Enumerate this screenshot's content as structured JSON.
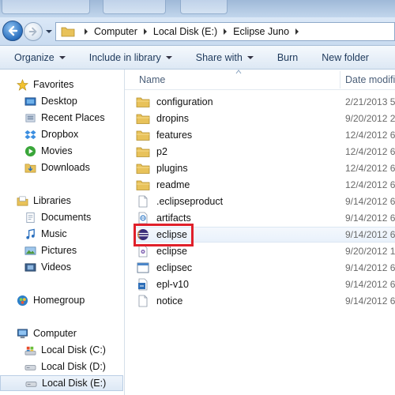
{
  "address_bar": {
    "breadcrumbs": [
      "Computer",
      "Local Disk (E:)",
      "Eclipse Juno"
    ]
  },
  "toolbar": {
    "organize": "Organize",
    "include_in_library": "Include in library",
    "share_with": "Share with",
    "burn": "Burn",
    "new_folder": "New folder"
  },
  "nav_pane": {
    "favorites": {
      "label": "Favorites",
      "items": [
        "Desktop",
        "Recent Places",
        "Dropbox",
        "Movies",
        "Downloads"
      ]
    },
    "libraries": {
      "label": "Libraries",
      "items": [
        "Documents",
        "Music",
        "Pictures",
        "Videos"
      ]
    },
    "homegroup": {
      "label": "Homegroup"
    },
    "computer": {
      "label": "Computer",
      "items": [
        "Local Disk (C:)",
        "Local Disk (D:)",
        "Local Disk (E:)"
      ],
      "selected": "Local Disk (E:)"
    }
  },
  "columns": {
    "name": "Name",
    "date_modified": "Date modifi"
  },
  "files": [
    {
      "name": "configuration",
      "date": "2/21/2013 5",
      "type": "folder"
    },
    {
      "name": "dropins",
      "date": "9/20/2012 2",
      "type": "folder"
    },
    {
      "name": "features",
      "date": "12/4/2012 6",
      "type": "folder"
    },
    {
      "name": "p2",
      "date": "12/4/2012 6",
      "type": "folder"
    },
    {
      "name": "plugins",
      "date": "12/4/2012 6",
      "type": "folder"
    },
    {
      "name": "readme",
      "date": "12/4/2012 6",
      "type": "folder"
    },
    {
      "name": ".eclipseproduct",
      "date": "9/14/2012 6",
      "type": "file"
    },
    {
      "name": "artifacts",
      "date": "9/14/2012 6",
      "type": "xml"
    },
    {
      "name": "eclipse",
      "date": "9/14/2012 6",
      "type": "eclipse-app"
    },
    {
      "name": "eclipse",
      "date": "9/20/2012 1",
      "type": "config"
    },
    {
      "name": "eclipsec",
      "date": "9/14/2012 6",
      "type": "console-app"
    },
    {
      "name": "epl-v10",
      "date": "9/14/2012 6",
      "type": "html"
    },
    {
      "name": "notice",
      "date": "9/14/2012 6",
      "type": "file"
    }
  ],
  "highlighted_item": "eclipse",
  "colors": {
    "highlight_border": "#e0202a",
    "folder_yellow": "#e8c25a",
    "toolbar_text": "#1e395b"
  }
}
